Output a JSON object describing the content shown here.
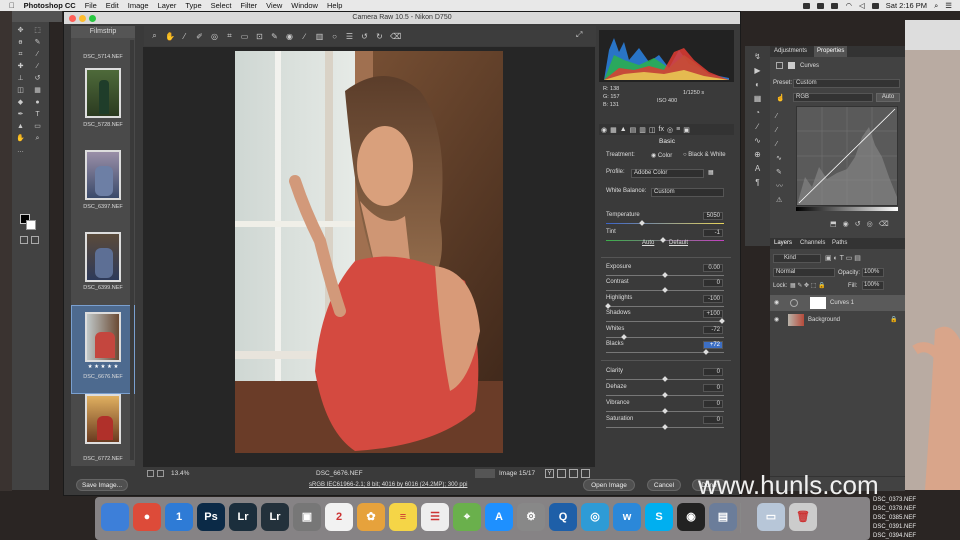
{
  "menubar": {
    "app": "Photoshop CC",
    "items": [
      "File",
      "Edit",
      "Image",
      "Layer",
      "Type",
      "Select",
      "Filter",
      "View",
      "Window",
      "Help"
    ],
    "clock": "Sat 2:16 PM"
  },
  "camera_raw": {
    "title": "Camera Raw 10.5  -  Nikon D750",
    "filmstrip_title": "Filmstrip",
    "thumbnails": [
      {
        "name": "DSC_5714.NEF"
      },
      {
        "name": "DSC_5728.NEF"
      },
      {
        "name": "DSC_6397.NEF"
      },
      {
        "name": "DSC_6399.NEF"
      },
      {
        "name": "DSC_6676.NEF"
      },
      {
        "name": "DSC_6772.NEF"
      }
    ],
    "rating_stars": "★ ★ ★ ★ ★",
    "zoom": "13.4%",
    "filename": "DSC_6676.NEF",
    "image_counter": "Image 15/17",
    "workflow_link": "sRGB IEC61966-2.1; 8 bit; 4016 by 6016 (24.2MP); 300 ppi",
    "buttons": {
      "save": "Save Image...",
      "open": "Open Image",
      "cancel": "Cancel",
      "done": "Done"
    },
    "readout": {
      "r": "R:  138",
      "g": "G:  157",
      "b": "B:  131",
      "shutter": "1/1250 s",
      "iso": "ISO 400"
    },
    "panel": {
      "tab": "Basic",
      "treatment_label": "Treatment:",
      "treatment_color": "Color",
      "treatment_bw": "Black & White",
      "profile_label": "Profile:",
      "profile_value": "Adobe Color",
      "wb_label": "White Balance:",
      "wb_value": "Custom",
      "auto": "Auto",
      "default": "Default",
      "sliders": [
        {
          "label": "Temperature",
          "value": "5050"
        },
        {
          "label": "Tint",
          "value": "-1"
        },
        {
          "label": "Exposure",
          "value": "0.00"
        },
        {
          "label": "Contrast",
          "value": "0"
        },
        {
          "label": "Highlights",
          "value": "-100"
        },
        {
          "label": "Shadows",
          "value": "+100"
        },
        {
          "label": "Whites",
          "value": "-72"
        },
        {
          "label": "Blacks",
          "value": "+72"
        },
        {
          "label": "Clarity",
          "value": "0"
        },
        {
          "label": "Dehaze",
          "value": "0"
        },
        {
          "label": "Vibrance",
          "value": "0"
        },
        {
          "label": "Saturation",
          "value": "0"
        }
      ]
    }
  },
  "properties": {
    "tabs": [
      "Adjustments",
      "Properties"
    ],
    "title": "Curves",
    "preset_label": "Preset:",
    "preset_value": "Custom",
    "channel": "RGB",
    "auto": "Auto"
  },
  "layers": {
    "tabs": [
      "Layers",
      "Channels",
      "Paths"
    ],
    "kind": "Kind",
    "blend": "Normal",
    "opacity_label": "Opacity:",
    "opacity": "100%",
    "lock_label": "Lock:",
    "fill_label": "Fill:",
    "fill": "100%",
    "items": [
      {
        "name": "Curves 1"
      },
      {
        "name": "Background"
      }
    ]
  },
  "dock": {
    "apps": [
      {
        "name": "Finder",
        "glyph": "",
        "color": "#3d7fd9"
      },
      {
        "name": "Chrome",
        "glyph": "●",
        "color": "#dd4b39"
      },
      {
        "name": "1Password",
        "glyph": "1",
        "color": "#2e7bd6"
      },
      {
        "name": "Photoshop",
        "glyph": "Ps",
        "color": "#0b2a47"
      },
      {
        "name": "Lightroom",
        "glyph": "Lr",
        "color": "#1b2e3c"
      },
      {
        "name": "Lightroom Classic",
        "glyph": "Lr",
        "color": "#23313b"
      },
      {
        "name": "Preview",
        "glyph": "▣",
        "color": "#777"
      },
      {
        "name": "Calendar",
        "glyph": "2",
        "color": "#f2f2f2"
      },
      {
        "name": "Photos",
        "glyph": "✿",
        "color": "#e6a23c"
      },
      {
        "name": "Notes",
        "glyph": "≡",
        "color": "#f5d547"
      },
      {
        "name": "Reminders",
        "glyph": "☰",
        "color": "#eee"
      },
      {
        "name": "Maps",
        "glyph": "⌖",
        "color": "#6ab04c"
      },
      {
        "name": "App Store",
        "glyph": "A",
        "color": "#1e90ff"
      },
      {
        "name": "System Preferences",
        "glyph": "⚙",
        "color": "#888"
      },
      {
        "name": "QuickTime",
        "glyph": "Q",
        "color": "#1e5fa8"
      },
      {
        "name": "Network",
        "glyph": "◎",
        "color": "#2e9bd6"
      },
      {
        "name": "Wunderlist",
        "glyph": "w",
        "color": "#2b88d9"
      },
      {
        "name": "Skype",
        "glyph": "S",
        "color": "#00aff0"
      },
      {
        "name": "OBS",
        "glyph": "◉",
        "color": "#222"
      },
      {
        "name": "Screenshot",
        "glyph": "▤",
        "color": "#6b7d9a"
      },
      {
        "name": "Folder",
        "glyph": "▭",
        "color": "#b7c6d8"
      },
      {
        "name": "Trash",
        "glyph": "🗑",
        "color": "#ccc"
      }
    ]
  },
  "watermark": "www.hunls.com",
  "files": [
    "DSC_0373.NEF",
    "DSC_0378.NEF",
    "DSC_0385.NEF",
    "DSC_0391.NEF",
    "DSC_0394.NEF"
  ]
}
